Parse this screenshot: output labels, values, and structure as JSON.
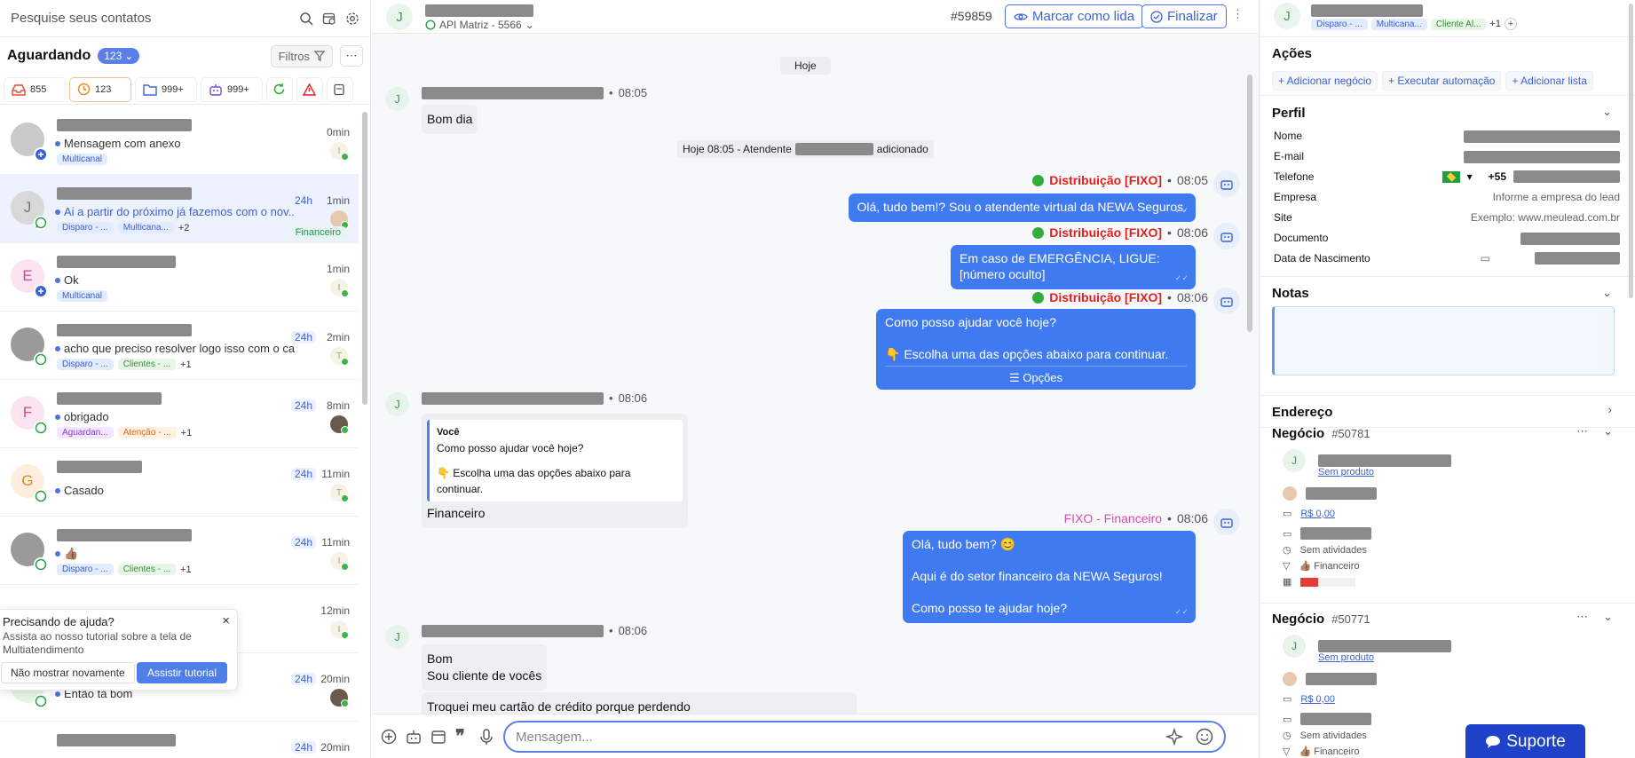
{
  "left": {
    "search_placeholder": "Pesquise seus contatos",
    "queue_title": "Aguardando",
    "queue_count": "123",
    "filters_label": "Filtros",
    "stats": [
      {
        "label": "855",
        "icon": "inbox-icon",
        "color": "#e44d2e"
      },
      {
        "label": "123",
        "icon": "clock-icon",
        "color": "#f08a24"
      },
      {
        "label": "999+",
        "icon": "folder-icon",
        "color": "#3b63d6"
      },
      {
        "label": "999+",
        "icon": "robot-icon",
        "color": "#7b4ad8"
      }
    ],
    "conversations": [
      {
        "avatar": "",
        "msg": "Mensagem com anexo",
        "tags": [
          "Multicanal"
        ],
        "more": "",
        "time": "0min",
        "h24": "",
        "agent": "I",
        "extra": ""
      },
      {
        "avatar": "J",
        "msg": "Ai a partir do próximo já fazemos com o nov...",
        "tags": [
          "Disparo - ...",
          "Multicana..."
        ],
        "more": "+2",
        "time": "1min",
        "h24": "24h",
        "agent": "",
        "extra": "Financeiro"
      },
      {
        "avatar": "E",
        "msg": "Ok",
        "tags": [
          "Multicanal"
        ],
        "more": "",
        "time": "1min",
        "h24": "",
        "agent": "I",
        "extra": ""
      },
      {
        "avatar": "",
        "msg": "acho que preciso resolver logo isso com o ca",
        "tags": [
          "Disparo - ...",
          "Clientes - ..."
        ],
        "more": "+1",
        "time": "2min",
        "h24": "24h",
        "agent": "T",
        "extra": ""
      },
      {
        "avatar": "F",
        "msg": "obrigado",
        "tags": [
          "Aguardan...",
          "Atenção - ..."
        ],
        "more": "+1",
        "time": "8min",
        "h24": "24h",
        "agent": "",
        "extra": ""
      },
      {
        "avatar": "G",
        "msg": "Casado",
        "tags": [],
        "more": "",
        "time": "11min",
        "h24": "24h",
        "agent": "T",
        "extra": ""
      },
      {
        "avatar": "",
        "msg": "👍🏽",
        "tags": [
          "Disparo - ...",
          "Clientes - ..."
        ],
        "more": "+1",
        "time": "11min",
        "h24": "24h",
        "agent": "I",
        "extra": ""
      },
      {
        "avatar": "",
        "msg": "",
        "tags": [],
        "more": "",
        "time": "12min",
        "h24": "",
        "agent": "I",
        "extra": ""
      },
      {
        "avatar": "V",
        "msg": "Então tá bom",
        "tags": [],
        "more": "",
        "time": "20min",
        "h24": "24h",
        "agent": "",
        "extra": ""
      },
      {
        "avatar": "",
        "msg": "",
        "tags": [],
        "more": "",
        "time": "20min",
        "h24": "24h",
        "agent": "",
        "extra": ""
      }
    ],
    "help": {
      "title": "Precisando de ajuda?",
      "desc": "Assista ao nosso tutorial sobre a tela de Multiatendimento",
      "dismiss": "Não mostrar novamente",
      "watch": "Assistir tutorial"
    }
  },
  "chat": {
    "avatar": "J",
    "channel": "API Matriz - 5566",
    "ticket": "#59859",
    "mark_read": "Marcar como lida",
    "finish": "Finalizar",
    "day": "Hoje",
    "system_prefix": "Hoje 08:05 - Atendente",
    "system_suffix": "adicionado",
    "messages": {
      "m1_time": "08:05",
      "m1_text": "Bom dia",
      "o1_name": "Distribuição [FIXO]",
      "o1_time": "08:05",
      "o1_text": "Olá, tudo bem!? Sou o atendente virtual da NEWA Seguros.",
      "o2_name": "Distribuição [FIXO]",
      "o2_time": "08:06",
      "o2_l1": "Em caso de EMERGÊNCIA, LIGUE:",
      "o2_l2": "[número oculto]",
      "o3_name": "Distribuição [FIXO]",
      "o3_time": "08:06",
      "o3_l1": "Como posso ajudar você hoje?",
      "o3_l2": "👇 Escolha uma das opções abaixo para continuar.",
      "o3_opts": "Opções",
      "m2_time": "08:06",
      "m2_qname": "Você",
      "m2_q1": "Como posso ajudar você hoje?",
      "m2_q2": "👇 Escolha uma das opções abaixo para continuar.",
      "m2_text": "Financeiro",
      "o4_name": "FIXO - Financeiro",
      "o4_time": "08:06",
      "o4_l1": "Olá, tudo bem? 😊",
      "o4_l2": "Aqui é do setor financeiro da NEWA Seguros!",
      "o4_l3": "Como posso te ajudar hoje?",
      "m3_time": "08:06",
      "m3_l1": "Bom",
      "m3_l2": "Sou cliente de vocês",
      "m3_l3": "Troquei meu cartão de crédito porque perdendo"
    },
    "composer_placeholder": "Mensagem..."
  },
  "right": {
    "avatar": "J",
    "tags": [
      "Disparo - ...",
      "Multicana...",
      "Cliente Al..."
    ],
    "tags_more": "+1",
    "actions_title": "Ações",
    "actions": [
      "+ Adicionar negócio",
      "+ Executar automação",
      "+ Adicionar lista"
    ],
    "profile_title": "Perfil",
    "fields": [
      {
        "label": "Nome",
        "value": ""
      },
      {
        "label": "E-mail",
        "value": ""
      },
      {
        "label": "Telefone",
        "value": "+55"
      },
      {
        "label": "Empresa",
        "value": "Informe a empresa do lead"
      },
      {
        "label": "Site",
        "value": "Exemplo: www.meulead.com.br"
      },
      {
        "label": "Documento",
        "value": ""
      },
      {
        "label": "Data de Nascimento",
        "value": ""
      }
    ],
    "notes_title": "Notas",
    "address_title": "Endereço",
    "deals": [
      {
        "title": "Negócio",
        "id": "#50781",
        "product": "Sem produto",
        "value": "R$ 0,00",
        "activities": "Sem atividades",
        "stage": "👍🏽 Financeiro"
      },
      {
        "title": "Negócio",
        "id": "#50771",
        "product": "Sem produto",
        "value": "R$ 0,00",
        "activities": "Sem atividades",
        "stage": "👍🏽 Financeiro"
      }
    ],
    "support": "Suporte"
  },
  "colors": {
    "accent": "#3f7af0",
    "brand": "#1e43c8",
    "bot_name": "#e02020"
  }
}
